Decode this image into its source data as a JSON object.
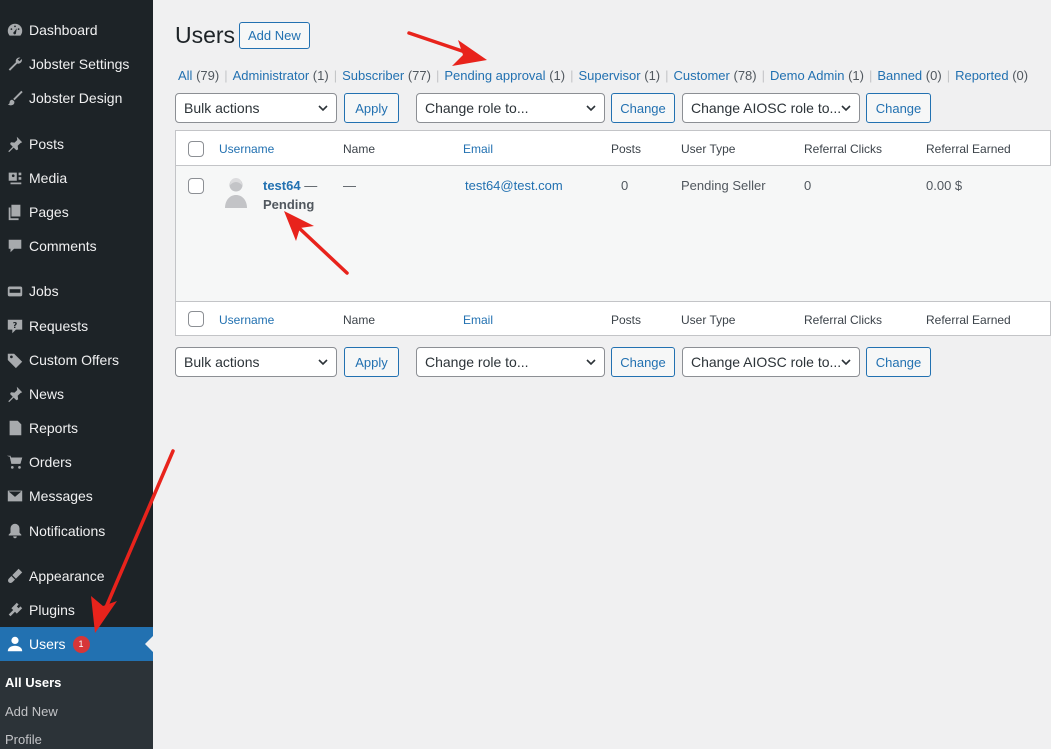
{
  "sidebar": {
    "items": [
      {
        "label": "Dashboard",
        "icon": "dashboard-icon"
      },
      {
        "label": "Jobster Settings",
        "icon": "wrench-icon"
      },
      {
        "label": "Jobster Design",
        "icon": "brush-icon"
      },
      {
        "label": "Posts",
        "icon": "pin-icon"
      },
      {
        "label": "Media",
        "icon": "media-icon"
      },
      {
        "label": "Pages",
        "icon": "pages-icon"
      },
      {
        "label": "Comments",
        "icon": "comment-icon"
      },
      {
        "label": "Jobs",
        "icon": "job-icon"
      },
      {
        "label": "Requests",
        "icon": "question-icon"
      },
      {
        "label": "Custom Offers",
        "icon": "tag-icon"
      },
      {
        "label": "News",
        "icon": "pin-icon"
      },
      {
        "label": "Reports",
        "icon": "reports-icon"
      },
      {
        "label": "Orders",
        "icon": "cart-icon"
      },
      {
        "label": "Messages",
        "icon": "mail-icon"
      },
      {
        "label": "Notifications",
        "icon": "bell-icon"
      },
      {
        "label": "Appearance",
        "icon": "appearance-icon"
      },
      {
        "label": "Plugins",
        "icon": "plugin-icon"
      },
      {
        "label": "Users",
        "icon": "user-icon",
        "badge": "1",
        "active": true
      }
    ],
    "submenu": [
      "All Users",
      "Add New",
      "Profile"
    ]
  },
  "page": {
    "title": "Users",
    "add_new": "Add New"
  },
  "filters": [
    {
      "label": "All",
      "count": "(79)"
    },
    {
      "label": "Administrator",
      "count": "(1)"
    },
    {
      "label": "Subscriber",
      "count": "(77)"
    },
    {
      "label": "Pending approval",
      "count": "(1)"
    },
    {
      "label": "Supervisor",
      "count": "(1)"
    },
    {
      "label": "Customer",
      "count": "(78)"
    },
    {
      "label": "Demo Admin",
      "count": "(1)"
    },
    {
      "label": "Banned",
      "count": "(0)"
    },
    {
      "label": "Reported",
      "count": "(0)"
    }
  ],
  "toolbar": {
    "bulk_actions": "Bulk actions",
    "apply": "Apply",
    "change_role": "Change role to...",
    "change": "Change",
    "change_aiosc": "Change AIOSC role to...",
    "change2": "Change"
  },
  "table": {
    "columns": [
      "Username",
      "Name",
      "Email",
      "Posts",
      "User Type",
      "Referral Clicks",
      "Referral Earned"
    ],
    "rows": [
      {
        "username": "test64",
        "username_suffix": " —",
        "status": "Pending",
        "name": "—",
        "email": "test64@test.com",
        "posts": "0",
        "user_type": "Pending Seller",
        "referral_clicks": "0",
        "referral_earned": "0.00 $"
      }
    ]
  },
  "colors": {
    "sidebar_bg": "#1d2327",
    "accent": "#2271b1",
    "badge": "#d63638",
    "arrow": "#e8231c"
  }
}
